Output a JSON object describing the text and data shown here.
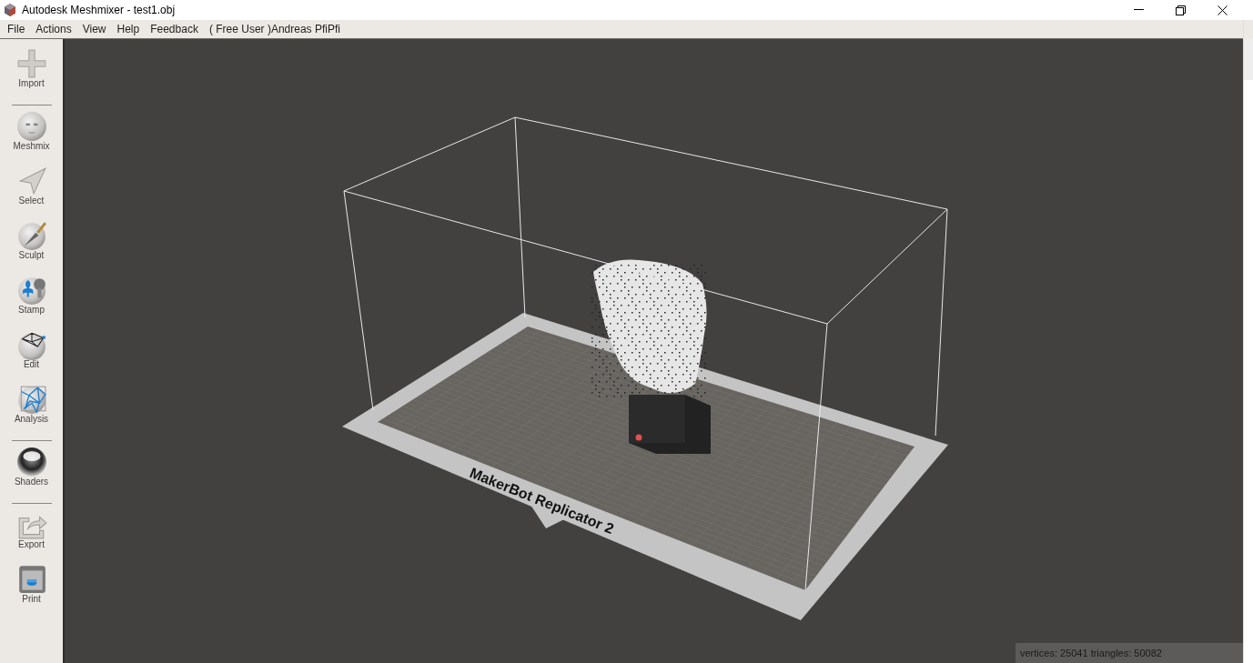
{
  "window": {
    "title": "Autodesk Meshmixer - test1.obj"
  },
  "menu": [
    {
      "label": "File"
    },
    {
      "label": "Actions"
    },
    {
      "label": "View"
    },
    {
      "label": "Help"
    },
    {
      "label": "Feedback"
    },
    {
      "label": "( Free User )Andreas PfiPfi"
    }
  ],
  "tool_groups": [
    [
      {
        "label": "Import"
      }
    ],
    [
      {
        "label": "Meshmix"
      },
      {
        "label": "Select"
      },
      {
        "label": "Sculpt"
      },
      {
        "label": "Stamp"
      },
      {
        "label": "Edit"
      },
      {
        "label": "Analysis"
      }
    ],
    [
      {
        "label": "Shaders"
      }
    ],
    [
      {
        "label": "Export"
      },
      {
        "label": "Print"
      }
    ]
  ],
  "viewport": {
    "printer_label": "MakerBot Replicator 2"
  },
  "status_bar": {
    "text": "vertices: 25041 triangles: 50082"
  }
}
